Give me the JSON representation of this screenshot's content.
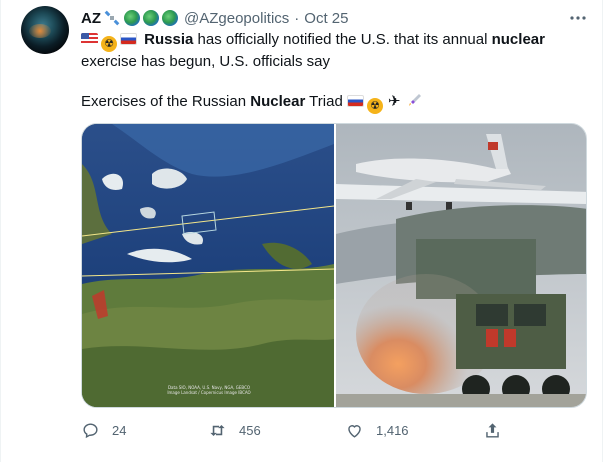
{
  "tweet": {
    "author_name": "AZ",
    "author_emoji": [
      "satellite",
      "globe-africa",
      "globe-americas",
      "globe-asia"
    ],
    "handle": "@AZgeopolitics",
    "separator": "·",
    "time": "Oct 25",
    "line1_prefix_emoji": [
      "us-flag",
      "radioactive",
      "russia-flag"
    ],
    "line1_bold_1": "Russia",
    "line1_mid": " has officially notified the U.S. that its annual ",
    "line1_bold_2": "nuclear",
    "line2": "exercise has begun, U.S. officials say",
    "line3_pre": "Exercises of the Russian ",
    "line3_bold": "Nuclear",
    "line3_post": " Triad ",
    "line3_emoji": [
      "russia-flag",
      "radioactive",
      "airplane",
      "rocket"
    ],
    "map_caption": "Data SIO, NOAA, U.S. Navy, NGA, GEBCO Image Landsat / Copernicus Image IBCAO",
    "counts": {
      "replies": "24",
      "retweets": "456",
      "likes": "1,416"
    }
  },
  "colors": {
    "text": "#0f1419",
    "secondary": "#536471",
    "border": "#cfd9de"
  }
}
